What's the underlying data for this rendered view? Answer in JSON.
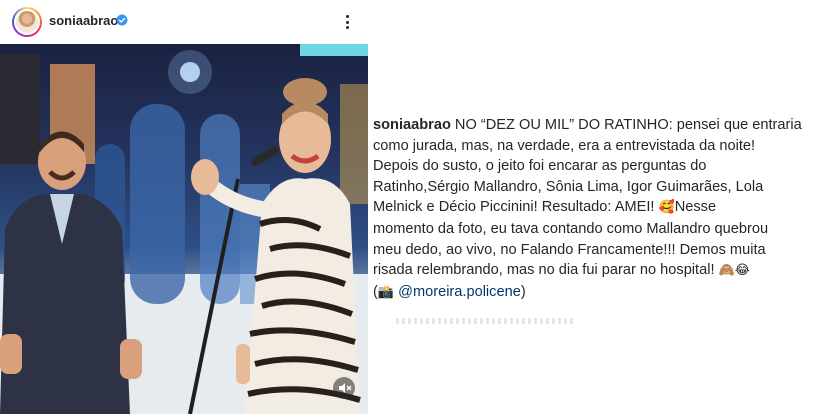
{
  "post": {
    "username": "soniaabrao",
    "verified": true,
    "avatar_icon": "profile-avatar",
    "more_icon": "more-vertical-icon",
    "accent_color": "#3897f0"
  },
  "caption": {
    "username": "soniaabrao",
    "lines": [
      " NO “DEZ OU MIL” DO RATINHO: pensei que entraria",
      "como jurada, mas, na verdade, era a entrevistada da noite!",
      "Depois do susto, o jeito foi encarar as perguntas do",
      "Ratinho,Sérgio Mallandro, Sônia Lima, Igor Guimarães, Lola",
      "Melnick e Décio Piccinini! Resultado: AMEI! ",
      "momento da foto, eu tava contando como Mallandro quebrou",
      "meu dedo, ao vivo, no Falando Francamente!!! Demos muita",
      "risada relembrando, mas no dia fui parar no hospital! "
    ],
    "line5_tail": "Nesse",
    "emoji_love": "🥰",
    "emoji_monkey_laugh": "🙈😂",
    "camera_emoji": "📸",
    "credit_open": "(",
    "credit_mention": "@moreira.policene",
    "credit_close": ")"
  }
}
